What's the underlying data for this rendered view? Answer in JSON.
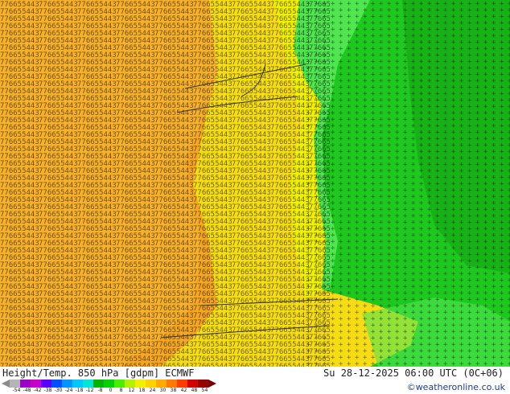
{
  "header": {
    "title_left": "Height/Temp. 850 hPa [gdpm] ECMWF",
    "title_right": "Su 28-12-2025 06:00 UTC (0C+06)",
    "credit": "©weatheronline.co.uk"
  },
  "colorbar": {
    "labels": [
      "-54",
      "-48",
      "-42",
      "-38",
      "-30",
      "-24",
      "-18",
      "-12",
      "-8",
      "0",
      "8",
      "12",
      "18",
      "24",
      "30",
      "38",
      "42",
      "48",
      "54"
    ],
    "colors": [
      "#8c8c8c",
      "#b5b5b5",
      "#9b00c8",
      "#c800c8",
      "#5a00ff",
      "#0050ff",
      "#0096ff",
      "#00c8ff",
      "#00e6d2",
      "#00b400",
      "#00d200",
      "#4bee00",
      "#b4f000",
      "#f0f000",
      "#ffd200",
      "#ffaa00",
      "#ff7800",
      "#ff3c00",
      "#d20000",
      "#960000",
      "#6e0000"
    ]
  },
  "map": {
    "colors": {
      "green_dark": "#14a014",
      "green": "#1ec81e",
      "green_light": "#50e650",
      "yellow": "#f5dc14",
      "yellow_bright": "#f0f000",
      "orange_light": "#f7c233",
      "orange": "#f5a623"
    }
  }
}
